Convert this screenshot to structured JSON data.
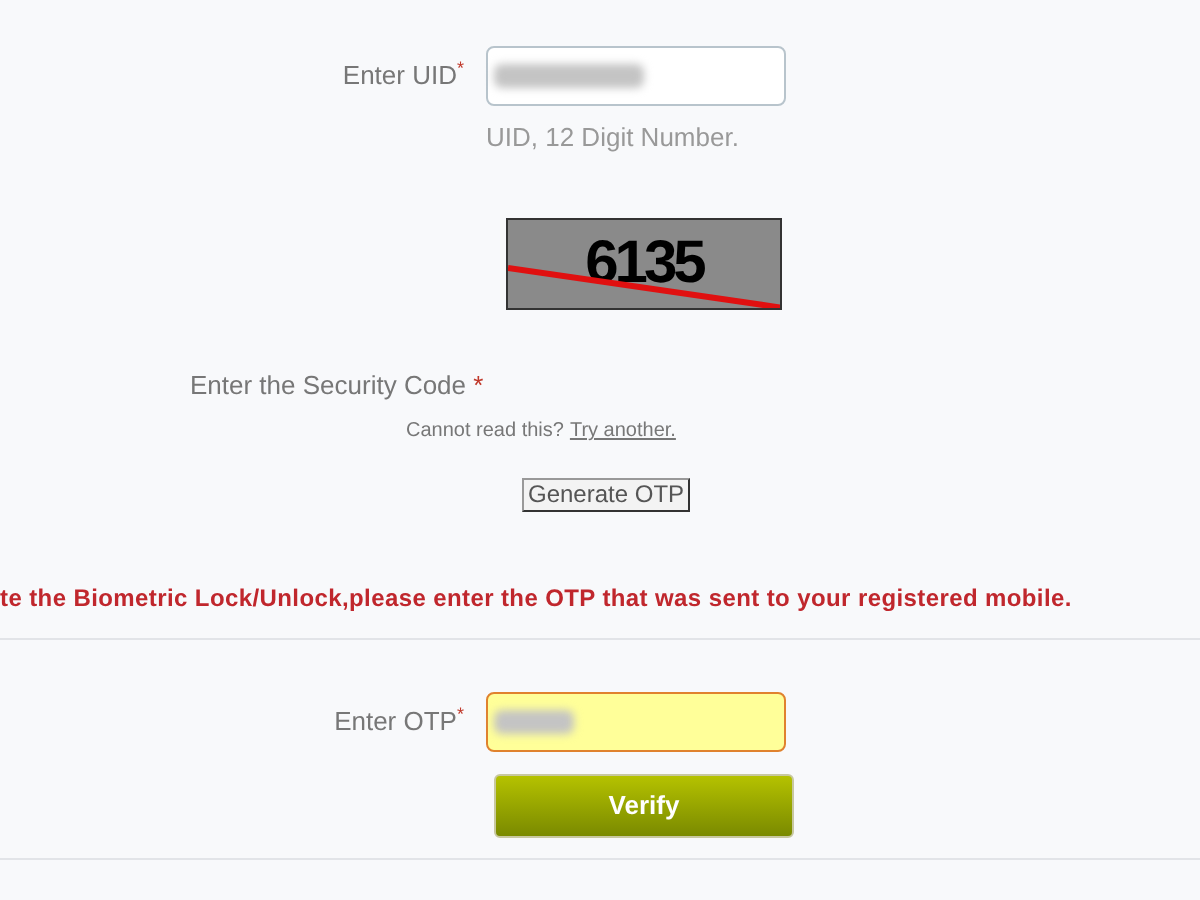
{
  "uid": {
    "label": "Enter UID",
    "required_mark": "*",
    "hint": "UID, 12 Digit Number.",
    "redacted": true
  },
  "captcha": {
    "code": "6135"
  },
  "security_code": {
    "label": "Enter the Security Code",
    "required_mark": "*",
    "prompt": "Cannot read this?",
    "link": "Try another."
  },
  "generate_button": "Generate OTP",
  "message": "te the Biometric Lock/Unlock,please enter the OTP that was sent to your registered mobile.",
  "otp": {
    "label": "Enter OTP",
    "required_mark": "*",
    "redacted": true,
    "highlighted": true
  },
  "verify_button": "Verify"
}
